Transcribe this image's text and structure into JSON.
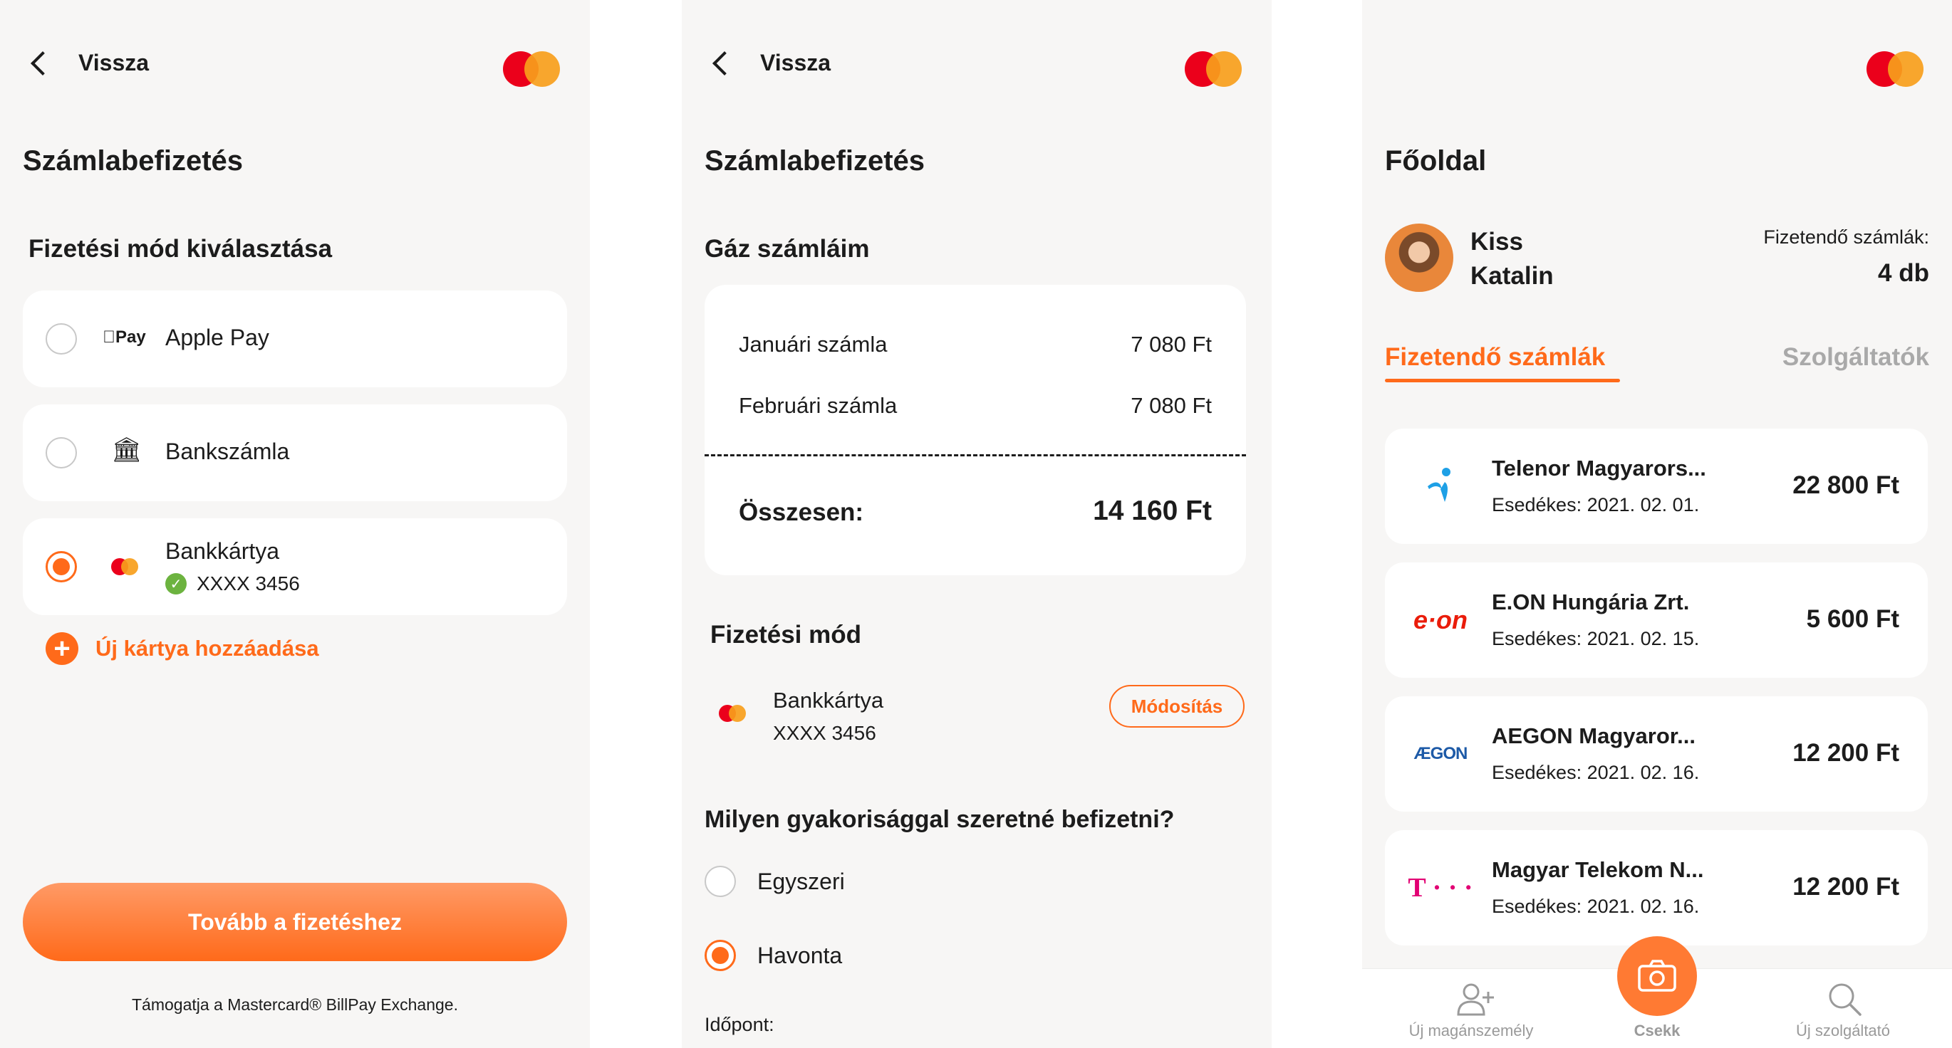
{
  "colors": {
    "accent": "#ff6a1a",
    "success": "#6cb33f",
    "mc_red": "#eb001b",
    "mc_orange": "#f79e1b",
    "telenor": "#1ea0e6",
    "eon": "#ea1c0a",
    "aegon": "#1d5aa7",
    "telekom": "#e20074"
  },
  "screen1": {
    "back_label": "Vissza",
    "title": "Számlabefizetés",
    "section": "Fizetési mód kiválasztása",
    "options": [
      {
        "icon": "apple-pay-icon",
        "icon_text": "Pay",
        "label": "Apple Pay",
        "selected": false
      },
      {
        "icon": "bank-icon",
        "icon_text": "🏛",
        "label": "Bankszámla",
        "selected": false
      },
      {
        "icon": "mastercard-icon",
        "label": "Bankkártya",
        "sub": "XXXX 3456",
        "selected": true
      }
    ],
    "add_card": "Új kártya hozzáadása",
    "continue": "Tovább a fizetéshez",
    "footer": "Támogatja a Mastercard® BillPay Exchange."
  },
  "screen2": {
    "back_label": "Vissza",
    "title": "Számlabefizetés",
    "section": "Gáz számláim",
    "bills": [
      {
        "name": "Januári számla",
        "amount": "7 080 Ft"
      },
      {
        "name": "Februári számla",
        "amount": "7 080 Ft"
      }
    ],
    "total_label": "Összesen:",
    "total_amount": "14 160 Ft",
    "payment_section": "Fizetési mód",
    "payment_name": "Bankkártya",
    "payment_card": "XXXX 3456",
    "modify": "Módosítás",
    "frequency_question": "Milyen gyakorisággal szeretné befizetni?",
    "frequency_options": [
      {
        "label": "Egyszeri",
        "selected": false
      },
      {
        "label": "Havonta",
        "selected": true
      }
    ],
    "time_label": "Időpont:"
  },
  "screen3": {
    "title": "Főoldal",
    "user_first": "Kiss",
    "user_last": "Katalin",
    "due_label": "Fizetendő számlák:",
    "due_count": "4 db",
    "tabs": [
      {
        "label": "Fizetendő számlák",
        "active": true
      },
      {
        "label": "Szolgáltatók",
        "active": false
      }
    ],
    "bills": [
      {
        "name": "Telenor Magyarors...",
        "due": "Esedékes: 2021. 02. 01.",
        "amount": "22 800 Ft",
        "logo": "telenor-logo"
      },
      {
        "name": "E.ON Hungária Zrt.",
        "due": "Esedékes: 2021. 02. 15.",
        "amount": "5 600 Ft",
        "logo": "eon-logo",
        "logo_text": "e·on"
      },
      {
        "name": "AEGON Magyaror...",
        "due": "Esedékes: 2021. 02. 16.",
        "amount": "12 200 Ft",
        "logo": "aegon-logo",
        "logo_text": "ÆGON"
      },
      {
        "name": "Magyar Telekom N...",
        "due": "Esedékes: 2021. 02. 16.",
        "amount": "12 200 Ft",
        "logo": "telekom-logo",
        "logo_text": "T · · ·"
      }
    ],
    "nav": [
      {
        "label": "Új magánszemély",
        "icon": "add-person-icon"
      },
      {
        "label": "Csekk",
        "icon": "camera-icon"
      },
      {
        "label": "Új szolgáltató",
        "icon": "search-icon"
      }
    ]
  }
}
